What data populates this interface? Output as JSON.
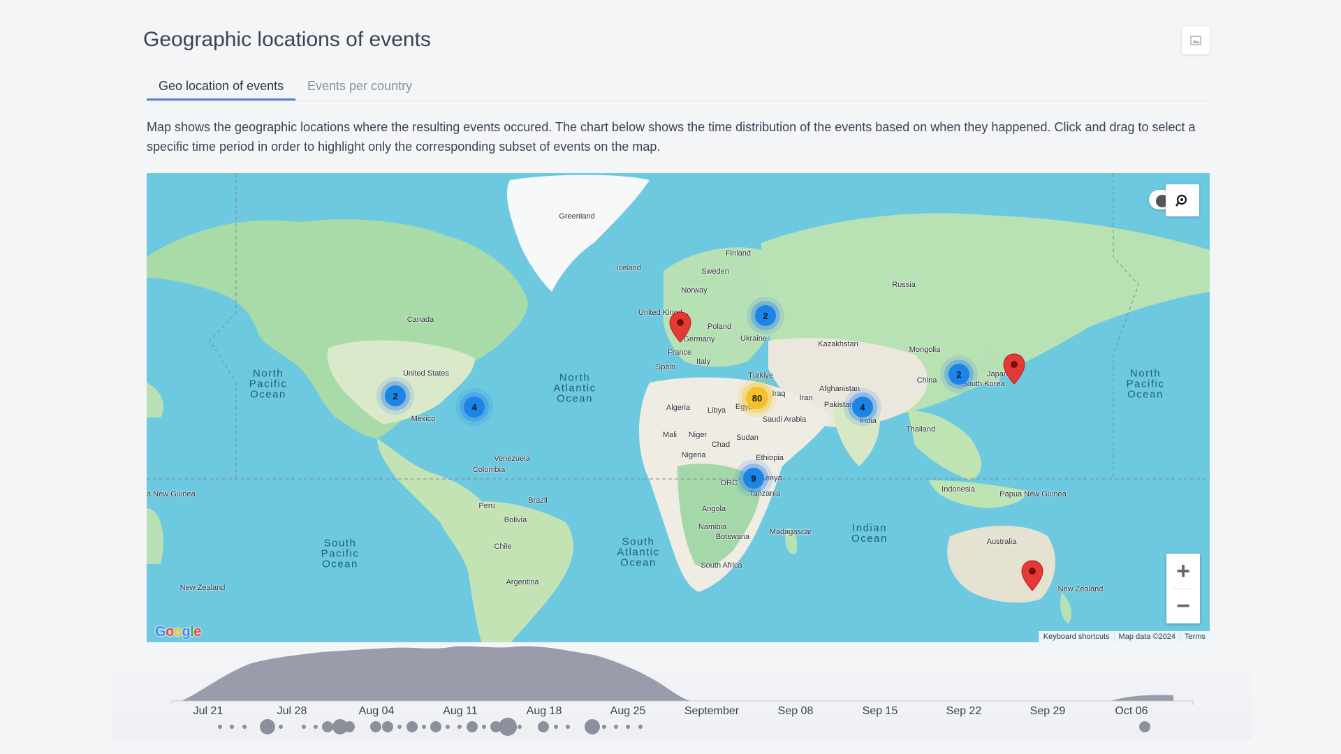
{
  "page": {
    "title": "Geographic locations of events",
    "export_icon": "image-icon"
  },
  "tabs": [
    {
      "label": "Geo location of events",
      "active": true
    },
    {
      "label": "Events per country",
      "active": false
    }
  ],
  "description": "Map shows the geographic locations where the resulting events occured. The chart below shows the time distribution of the events based on when they happened. Click and drag to select a specific time period in order to highlight only the corresponding subset of events on the map.",
  "map": {
    "country_labels": [
      "Greenland",
      "Iceland",
      "Finland",
      "Sweden",
      "Norway",
      "United Kingd...",
      "Russia",
      "Canada",
      "Poland",
      "Germany",
      "Ukraine",
      "France",
      "Kazakhstan",
      "Mongolia",
      "Spain",
      "Italy",
      "Türkiye",
      "United States",
      "China",
      "South Korea",
      "Japan",
      "Afghanistan",
      "Iraq",
      "Iran",
      "Pakistan",
      "Algeria",
      "Libya",
      "Egypt",
      "Saudi Arabia",
      "India",
      "Mexico",
      "Mali",
      "Niger",
      "Chad",
      "Sudan",
      "Thailand",
      "Nigeria",
      "Ethiopia",
      "Venezuela",
      "Colombia",
      "Kenya",
      "DRC",
      "Tanzania",
      "Indonesia",
      "Papua New Guinea",
      "Brazil",
      "Peru",
      "Bolivia",
      "Angola",
      "Namibia",
      "Botswana",
      "Madagascar",
      "Australia",
      "Chile",
      "South Africa",
      "Argentina",
      "New Zealand",
      "Papua New Guinea"
    ],
    "ocean_labels": [
      "North Pacific Ocean",
      "North Atlantic Ocean",
      "North Pacific Ocean",
      "South Pacific Ocean",
      "South Atlantic Ocean",
      "Indian Ocean"
    ],
    "clusters": [
      {
        "count": "2",
        "color": "blue",
        "region": "Eastern Europe"
      },
      {
        "count": "2",
        "color": "blue",
        "region": "Western United States"
      },
      {
        "count": "4",
        "color": "blue",
        "region": "Southeastern United States"
      },
      {
        "count": "80",
        "color": "yellow",
        "region": "Middle East"
      },
      {
        "count": "4",
        "color": "blue",
        "region": "India"
      },
      {
        "count": "2",
        "color": "blue",
        "region": "East Asia"
      },
      {
        "count": "9",
        "color": "blue",
        "region": "East Africa"
      }
    ],
    "pins": [
      "United Kingdom",
      "Japan",
      "Australia"
    ],
    "google_logo": "Google",
    "attribution": {
      "shortcuts": "Keyboard shortcuts",
      "map_data": "Map data ©2024",
      "terms": "Terms"
    },
    "controls": {
      "toggle_icon": "toggle-icon",
      "zoom_search_icon": "zoom-search-icon",
      "zoom_in": "+",
      "zoom_out": "−"
    }
  },
  "timeline": {
    "tick_labels": [
      "Jul 21",
      "Jul 28",
      "Aug 04",
      "Aug 11",
      "Aug 18",
      "Aug 25",
      "September",
      "Sep 08",
      "Sep 15",
      "Sep 22",
      "Sep 29",
      "Oct 06"
    ],
    "area_color": "#9a9cab"
  }
}
